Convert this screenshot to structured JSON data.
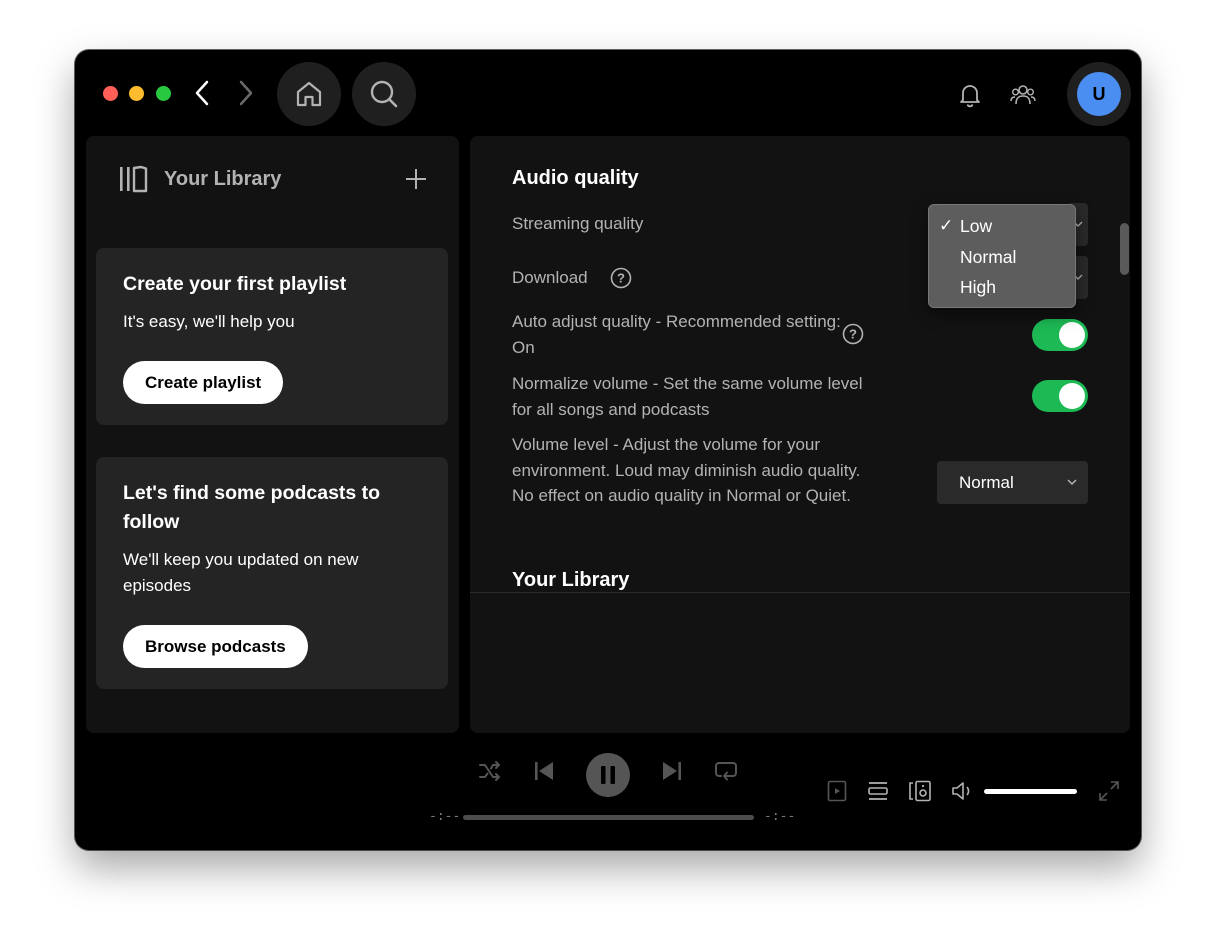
{
  "topbar": {
    "avatar_initial": "U"
  },
  "sidebar": {
    "title": "Your Library",
    "cards": [
      {
        "title": "Create your first playlist",
        "subtitle": "It's easy, we'll help you",
        "button": "Create playlist"
      },
      {
        "title": "Let's find some podcasts to follow",
        "subtitle": "We'll keep you updated on new episodes",
        "button": "Browse podcasts"
      }
    ]
  },
  "settings": {
    "audio_section": "Audio quality",
    "streaming_label": "Streaming quality",
    "download_label": "Download",
    "auto_adjust_label": "Auto adjust quality - Recommended setting: On",
    "auto_adjust_on": true,
    "normalize_label": "Normalize volume - Set the same volume level for all songs and podcasts",
    "normalize_on": true,
    "volume_level_label": "Volume level - Adjust the volume for your environment. Loud may diminish audio quality. No effect on audio quality in Normal or Quiet.",
    "volume_level_value": "Normal",
    "library_section": "Your Library"
  },
  "streaming_dropdown": {
    "options": [
      "Low",
      "Normal",
      "High"
    ],
    "selected": "Low",
    "check": "✓"
  },
  "player": {
    "elapsed": "-:--",
    "remaining": "-:--",
    "volume_fraction": 1.0
  },
  "colors": {
    "accent_green": "#1db954",
    "avatar_blue": "#4b8ef1"
  }
}
